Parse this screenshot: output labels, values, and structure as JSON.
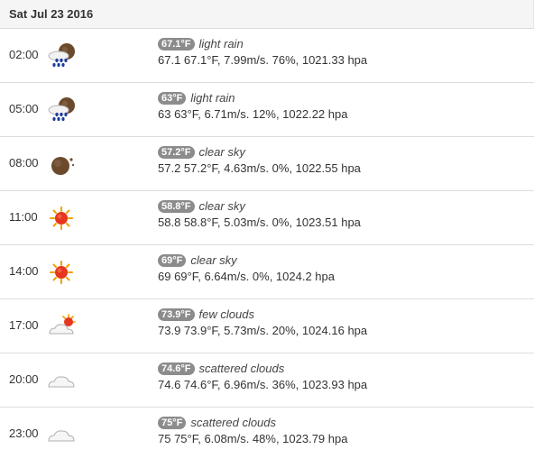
{
  "day": "Sat Jul 23 2016",
  "rows": [
    {
      "time": "02:00",
      "icon": "rain-night-icon",
      "badge": "67.1°F",
      "desc": "light rain",
      "details": "67.1 67.1°F, 7.99m/s. 76%, 1021.33 hpa"
    },
    {
      "time": "05:00",
      "icon": "rain-night-icon",
      "badge": "63°F",
      "desc": "light rain",
      "details": "63 63°F, 6.71m/s. 12%, 1022.22 hpa"
    },
    {
      "time": "08:00",
      "icon": "moon-icon",
      "badge": "57.2°F",
      "desc": "clear sky",
      "details": "57.2 57.2°F, 4.63m/s. 0%, 1022.55 hpa"
    },
    {
      "time": "11:00",
      "icon": "sun-icon",
      "badge": "58.8°F",
      "desc": "clear sky",
      "details": "58.8 58.8°F, 5.03m/s. 0%, 1023.51 hpa"
    },
    {
      "time": "14:00",
      "icon": "sun-icon",
      "badge": "69°F",
      "desc": "clear sky",
      "details": "69 69°F, 6.64m/s. 0%, 1024.2 hpa"
    },
    {
      "time": "17:00",
      "icon": "sun-cloud-icon",
      "badge": "73.9°F",
      "desc": "few clouds",
      "details": "73.9 73.9°F, 5.73m/s. 20%, 1024.16 hpa"
    },
    {
      "time": "20:00",
      "icon": "cloud-icon",
      "badge": "74.6°F",
      "desc": "scattered clouds",
      "details": "74.6 74.6°F, 6.96m/s. 36%, 1023.93 hpa"
    },
    {
      "time": "23:00",
      "icon": "cloud-icon",
      "badge": "75°F",
      "desc": "scattered clouds",
      "details": "75 75°F, 6.08m/s. 48%, 1023.79 hpa"
    }
  ],
  "colors": {
    "header_bg": "#f5f5f5",
    "badge_bg": "#8c8c8c",
    "sun": "#e8351e",
    "moon": "#6b4a2c",
    "rain": "#1c3d9c"
  }
}
